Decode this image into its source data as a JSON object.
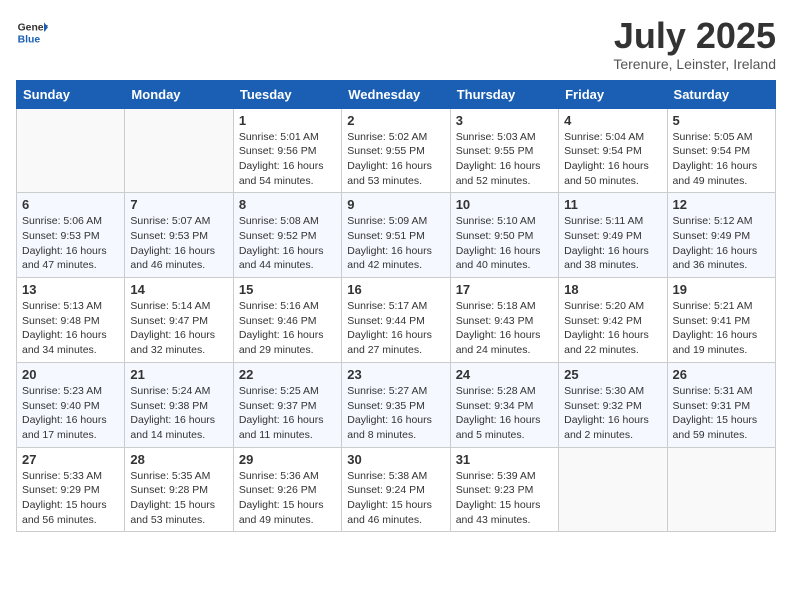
{
  "header": {
    "logo_line1": "General",
    "logo_line2": "Blue",
    "month": "July 2025",
    "location": "Terenure, Leinster, Ireland"
  },
  "days_of_week": [
    "Sunday",
    "Monday",
    "Tuesday",
    "Wednesday",
    "Thursday",
    "Friday",
    "Saturday"
  ],
  "weeks": [
    [
      {
        "day": "",
        "sunrise": "",
        "sunset": "",
        "daylight": ""
      },
      {
        "day": "",
        "sunrise": "",
        "sunset": "",
        "daylight": ""
      },
      {
        "day": "1",
        "sunrise": "Sunrise: 5:01 AM",
        "sunset": "Sunset: 9:56 PM",
        "daylight": "Daylight: 16 hours and 54 minutes."
      },
      {
        "day": "2",
        "sunrise": "Sunrise: 5:02 AM",
        "sunset": "Sunset: 9:55 PM",
        "daylight": "Daylight: 16 hours and 53 minutes."
      },
      {
        "day": "3",
        "sunrise": "Sunrise: 5:03 AM",
        "sunset": "Sunset: 9:55 PM",
        "daylight": "Daylight: 16 hours and 52 minutes."
      },
      {
        "day": "4",
        "sunrise": "Sunrise: 5:04 AM",
        "sunset": "Sunset: 9:54 PM",
        "daylight": "Daylight: 16 hours and 50 minutes."
      },
      {
        "day": "5",
        "sunrise": "Sunrise: 5:05 AM",
        "sunset": "Sunset: 9:54 PM",
        "daylight": "Daylight: 16 hours and 49 minutes."
      }
    ],
    [
      {
        "day": "6",
        "sunrise": "Sunrise: 5:06 AM",
        "sunset": "Sunset: 9:53 PM",
        "daylight": "Daylight: 16 hours and 47 minutes."
      },
      {
        "day": "7",
        "sunrise": "Sunrise: 5:07 AM",
        "sunset": "Sunset: 9:53 PM",
        "daylight": "Daylight: 16 hours and 46 minutes."
      },
      {
        "day": "8",
        "sunrise": "Sunrise: 5:08 AM",
        "sunset": "Sunset: 9:52 PM",
        "daylight": "Daylight: 16 hours and 44 minutes."
      },
      {
        "day": "9",
        "sunrise": "Sunrise: 5:09 AM",
        "sunset": "Sunset: 9:51 PM",
        "daylight": "Daylight: 16 hours and 42 minutes."
      },
      {
        "day": "10",
        "sunrise": "Sunrise: 5:10 AM",
        "sunset": "Sunset: 9:50 PM",
        "daylight": "Daylight: 16 hours and 40 minutes."
      },
      {
        "day": "11",
        "sunrise": "Sunrise: 5:11 AM",
        "sunset": "Sunset: 9:49 PM",
        "daylight": "Daylight: 16 hours and 38 minutes."
      },
      {
        "day": "12",
        "sunrise": "Sunrise: 5:12 AM",
        "sunset": "Sunset: 9:49 PM",
        "daylight": "Daylight: 16 hours and 36 minutes."
      }
    ],
    [
      {
        "day": "13",
        "sunrise": "Sunrise: 5:13 AM",
        "sunset": "Sunset: 9:48 PM",
        "daylight": "Daylight: 16 hours and 34 minutes."
      },
      {
        "day": "14",
        "sunrise": "Sunrise: 5:14 AM",
        "sunset": "Sunset: 9:47 PM",
        "daylight": "Daylight: 16 hours and 32 minutes."
      },
      {
        "day": "15",
        "sunrise": "Sunrise: 5:16 AM",
        "sunset": "Sunset: 9:46 PM",
        "daylight": "Daylight: 16 hours and 29 minutes."
      },
      {
        "day": "16",
        "sunrise": "Sunrise: 5:17 AM",
        "sunset": "Sunset: 9:44 PM",
        "daylight": "Daylight: 16 hours and 27 minutes."
      },
      {
        "day": "17",
        "sunrise": "Sunrise: 5:18 AM",
        "sunset": "Sunset: 9:43 PM",
        "daylight": "Daylight: 16 hours and 24 minutes."
      },
      {
        "day": "18",
        "sunrise": "Sunrise: 5:20 AM",
        "sunset": "Sunset: 9:42 PM",
        "daylight": "Daylight: 16 hours and 22 minutes."
      },
      {
        "day": "19",
        "sunrise": "Sunrise: 5:21 AM",
        "sunset": "Sunset: 9:41 PM",
        "daylight": "Daylight: 16 hours and 19 minutes."
      }
    ],
    [
      {
        "day": "20",
        "sunrise": "Sunrise: 5:23 AM",
        "sunset": "Sunset: 9:40 PM",
        "daylight": "Daylight: 16 hours and 17 minutes."
      },
      {
        "day": "21",
        "sunrise": "Sunrise: 5:24 AM",
        "sunset": "Sunset: 9:38 PM",
        "daylight": "Daylight: 16 hours and 14 minutes."
      },
      {
        "day": "22",
        "sunrise": "Sunrise: 5:25 AM",
        "sunset": "Sunset: 9:37 PM",
        "daylight": "Daylight: 16 hours and 11 minutes."
      },
      {
        "day": "23",
        "sunrise": "Sunrise: 5:27 AM",
        "sunset": "Sunset: 9:35 PM",
        "daylight": "Daylight: 16 hours and 8 minutes."
      },
      {
        "day": "24",
        "sunrise": "Sunrise: 5:28 AM",
        "sunset": "Sunset: 9:34 PM",
        "daylight": "Daylight: 16 hours and 5 minutes."
      },
      {
        "day": "25",
        "sunrise": "Sunrise: 5:30 AM",
        "sunset": "Sunset: 9:32 PM",
        "daylight": "Daylight: 16 hours and 2 minutes."
      },
      {
        "day": "26",
        "sunrise": "Sunrise: 5:31 AM",
        "sunset": "Sunset: 9:31 PM",
        "daylight": "Daylight: 15 hours and 59 minutes."
      }
    ],
    [
      {
        "day": "27",
        "sunrise": "Sunrise: 5:33 AM",
        "sunset": "Sunset: 9:29 PM",
        "daylight": "Daylight: 15 hours and 56 minutes."
      },
      {
        "day": "28",
        "sunrise": "Sunrise: 5:35 AM",
        "sunset": "Sunset: 9:28 PM",
        "daylight": "Daylight: 15 hours and 53 minutes."
      },
      {
        "day": "29",
        "sunrise": "Sunrise: 5:36 AM",
        "sunset": "Sunset: 9:26 PM",
        "daylight": "Daylight: 15 hours and 49 minutes."
      },
      {
        "day": "30",
        "sunrise": "Sunrise: 5:38 AM",
        "sunset": "Sunset: 9:24 PM",
        "daylight": "Daylight: 15 hours and 46 minutes."
      },
      {
        "day": "31",
        "sunrise": "Sunrise: 5:39 AM",
        "sunset": "Sunset: 9:23 PM",
        "daylight": "Daylight: 15 hours and 43 minutes."
      },
      {
        "day": "",
        "sunrise": "",
        "sunset": "",
        "daylight": ""
      },
      {
        "day": "",
        "sunrise": "",
        "sunset": "",
        "daylight": ""
      }
    ]
  ]
}
